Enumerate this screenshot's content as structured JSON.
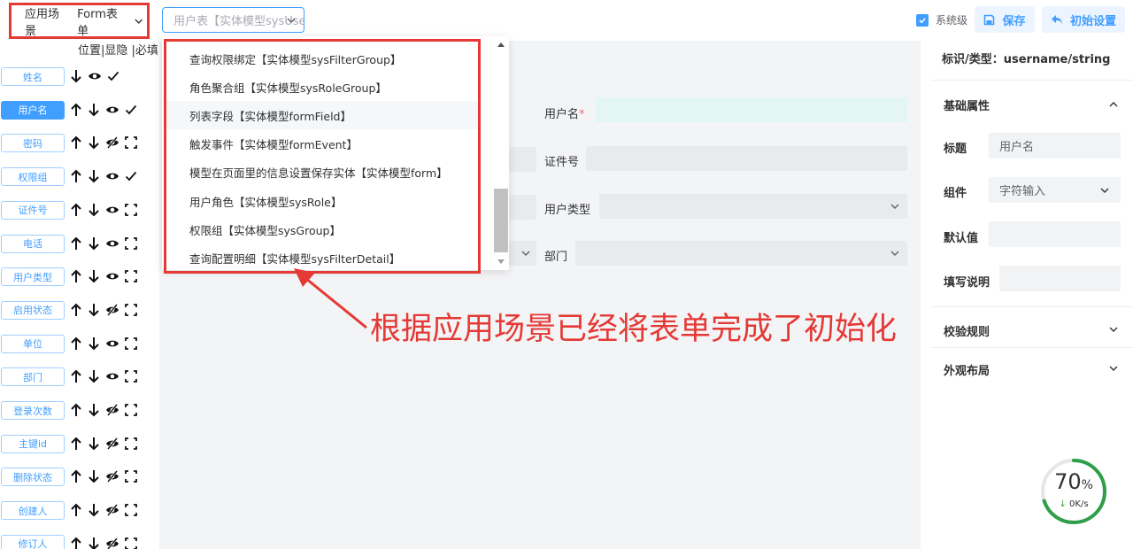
{
  "topbar": {
    "scene_label": "应用场景",
    "scene_value": "Form表单",
    "model_placeholder": "用户表【实体模型sysUser】",
    "system_level_label": "系统级",
    "save_label": "保存",
    "init_label": "初始设置"
  },
  "left": {
    "header": "位置|显隐 |必填",
    "fields": [
      {
        "label": "姓名",
        "active": false,
        "up": false,
        "visible": true,
        "required": true
      },
      {
        "label": "用户名",
        "active": true,
        "up": true,
        "visible": true,
        "required": true
      },
      {
        "label": "密码",
        "active": false,
        "up": true,
        "visible": false,
        "required": false
      },
      {
        "label": "权限组",
        "active": false,
        "up": true,
        "visible": true,
        "required": true
      },
      {
        "label": "证件号",
        "active": false,
        "up": true,
        "visible": true,
        "required": false
      },
      {
        "label": "电话",
        "active": false,
        "up": true,
        "visible": true,
        "required": false
      },
      {
        "label": "用户类型",
        "active": false,
        "up": true,
        "visible": true,
        "required": false
      },
      {
        "label": "启用状态",
        "active": false,
        "up": true,
        "visible": false,
        "required": false
      },
      {
        "label": "单位",
        "active": false,
        "up": true,
        "visible": true,
        "required": false
      },
      {
        "label": "部门",
        "active": false,
        "up": true,
        "visible": true,
        "required": false
      },
      {
        "label": "登录次数",
        "active": false,
        "up": true,
        "visible": false,
        "required": false
      },
      {
        "label": "主键id",
        "active": false,
        "up": true,
        "visible": false,
        "required": false
      },
      {
        "label": "删除状态",
        "active": false,
        "up": true,
        "visible": false,
        "required": false
      },
      {
        "label": "创建人",
        "active": false,
        "up": true,
        "visible": false,
        "required": false
      },
      {
        "label": "修订人",
        "active": false,
        "up": true,
        "visible": false,
        "required": false
      }
    ]
  },
  "form": {
    "username_label": "用户名",
    "id_label": "证件号",
    "usertype_label": "用户类型",
    "dept_label": "部门"
  },
  "dropdown": {
    "items": [
      "查询权限绑定【实体模型sysFilterGroup】",
      "角色聚合组【实体模型sysRoleGroup】",
      "列表字段【实体模型formField】",
      "触发事件【实体模型formEvent】",
      "模型在页面里的信息设置保存实体【实体模型form】",
      "用户角色【实体模型sysRole】",
      "权限组【实体模型sysGroup】",
      "查询配置明细【实体模型sysFilterDetail】"
    ],
    "hover_index": 2
  },
  "annotation": "根据应用场景已经将表单完成了初始化",
  "right": {
    "title": "标识/类型：username/string",
    "basic_section": "基础属性",
    "title_label": "标题",
    "title_value": "用户名",
    "component_label": "组件",
    "component_value": "字符输入",
    "default_label": "默认值",
    "hint_label": "填写说明",
    "validation_section": "校验规则",
    "appearance_section": "外观布局"
  },
  "network": {
    "percent": "70",
    "percent_unit": "%",
    "percent_value": 70,
    "speed": "0K/s",
    "arrow": "↓"
  },
  "colors": {
    "primary": "#409eff",
    "annotation_red": "#e53935",
    "gauge_green": "#2e9e4a"
  }
}
